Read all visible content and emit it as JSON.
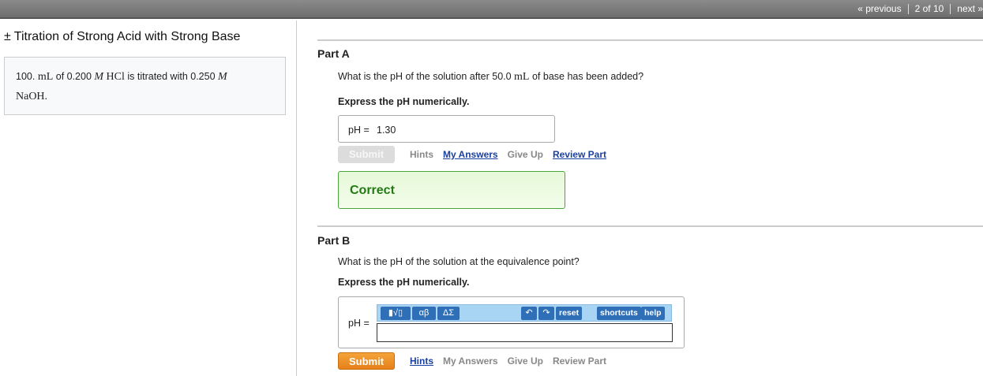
{
  "nav": {
    "previous": "« previous",
    "position": "2 of 10",
    "next": "next »"
  },
  "problem": {
    "title": "Titration of Strong Acid with Strong Base",
    "title_icon": "±",
    "t1": "100. ",
    "u1": "mL",
    "t2": " of 0.200 ",
    "m1": "M",
    "c1": "HCl",
    "t3": " is titrated with 0.250 ",
    "m2": "M",
    "c2": "NaOH."
  },
  "partA": {
    "label": "Part A",
    "q1": "What is the pH of the solution after 50.0 ",
    "q_unit": "mL",
    "q2": " of base has been added?",
    "instruction": "Express the pH numerically.",
    "answer_label": "pH =",
    "answer_value": "1.30",
    "submit": "Submit",
    "hints": "Hints",
    "my_answers": "My Answers",
    "give_up": "Give Up",
    "review": "Review Part",
    "feedback": "Correct"
  },
  "partB": {
    "label": "Part B",
    "question": "What is the pH of the solution at the equivalence point?",
    "instruction": "Express the pH numerically.",
    "answer_label": "pH =",
    "answer_value": "",
    "toolbar": {
      "templates": "▮√▯",
      "greek": "αβ",
      "symbols": "ΔΣ",
      "undo": "↶",
      "redo": "↷",
      "reset": "reset",
      "shortcuts": "shortcuts",
      "help": "help"
    },
    "submit": "Submit",
    "hints": "Hints",
    "my_answers": "My Answers",
    "give_up": "Give Up",
    "review": "Review Part"
  }
}
